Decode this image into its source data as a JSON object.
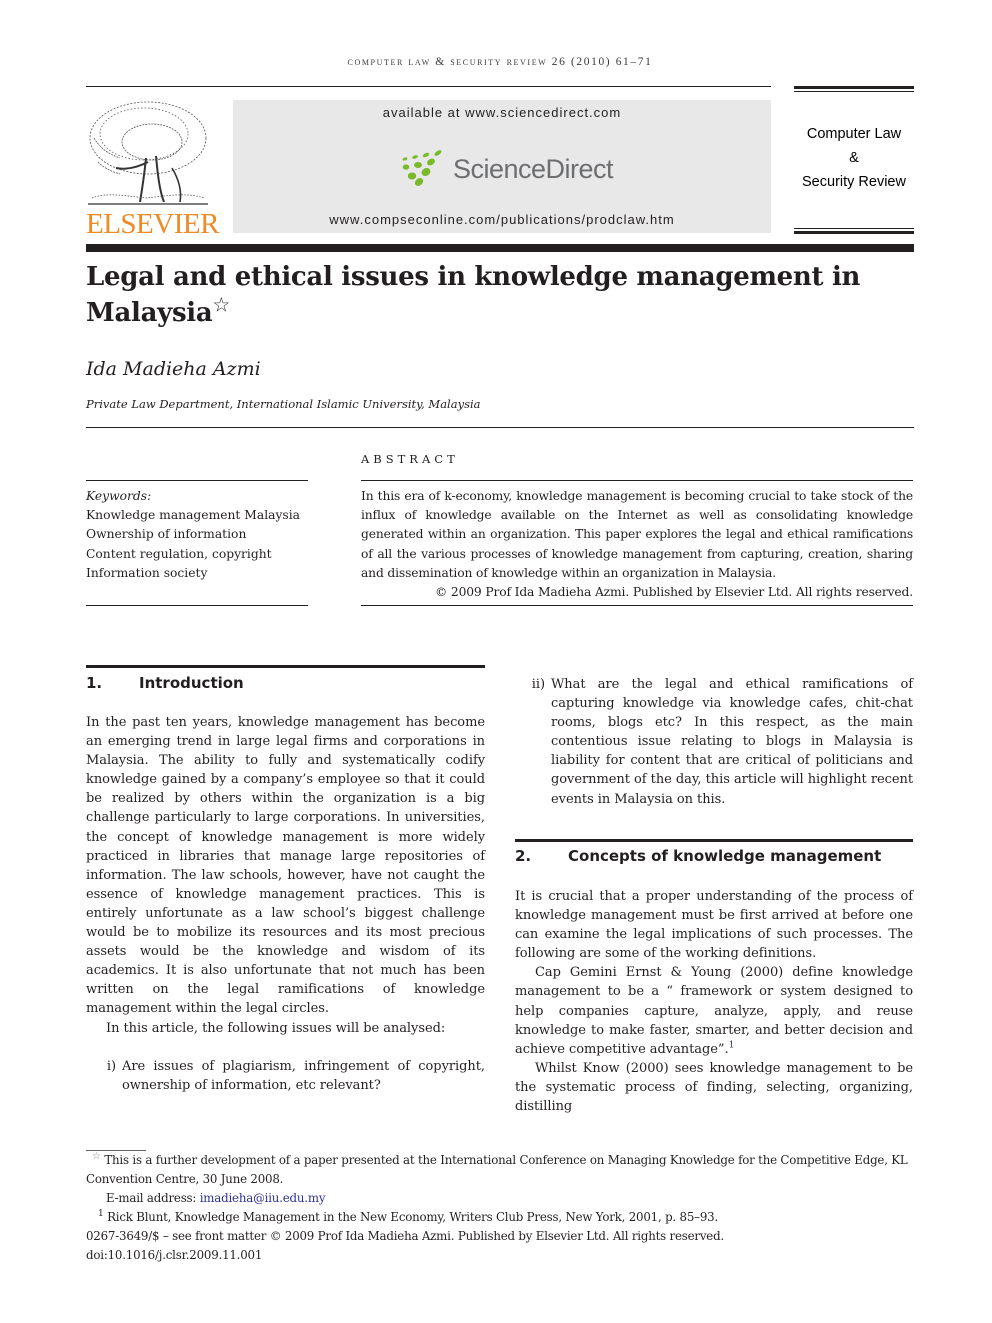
{
  "running_head": "Computer Law & Security Review 26 (2010) 61–71",
  "masthead": {
    "publisher": "ELSEVIER",
    "available_at": "available at www.sciencedirect.com",
    "platform": "ScienceDirect",
    "journal_url": "www.compseconline.com/publications/prodclaw.htm",
    "journal_name_line1": "Computer Law",
    "journal_name_line2": "&",
    "journal_name_line3": "Security Review",
    "colors": {
      "elsevier_orange": "#f08a24",
      "sciencedirect_green": "#7ab929",
      "sciencedirect_gray": "#6d6e71",
      "banner_bg": "#e8e8e8"
    }
  },
  "article": {
    "title": "Legal and ethical issues in knowledge management in Malaysia",
    "title_mark": "☆",
    "author": "Ida Madieha Azmi",
    "affiliation": "Private Law Department, International Islamic University, Malaysia"
  },
  "keywords": {
    "label": "Keywords:",
    "items": [
      "Knowledge management Malaysia",
      "Ownership of information",
      "Content regulation, copyright",
      "Information society"
    ]
  },
  "abstract": {
    "heading": "ABSTRACT",
    "text": "In this era of k-economy, knowledge management is becoming crucial to take stock of the influx of knowledge available on the Internet as well as consolidating knowledge generated within an organization. This paper explores the legal and ethical ramifications of all the various processes of knowledge management from capturing, creation, sharing and dissemination of knowledge within an organization in Malaysia.",
    "copyright": "© 2009 Prof Ida Madieha Azmi. Published by Elsevier Ltd. All rights reserved."
  },
  "sections": [
    {
      "number": "1.",
      "title": "Introduction",
      "paragraphs": [
        "In the past ten years, knowledge management has become an emerging trend in large legal firms and corporations in Malaysia. The ability to fully and systematically codify knowledge gained by a company’s employee so that it could be realized by others within the organization is a big challenge particularly to large corporations. In universities, the concept of knowledge management is more widely practiced in libraries that manage large repositories of information. The law schools, however, have not caught the essence of knowledge management practices. This is entirely unfortunate as a law school’s biggest challenge would be to mobilize its resources and its most precious assets would be the knowledge and wisdom of its academics. It is also unfortunate that not much has been written on the legal ramifications of knowledge management within the legal circles.",
        "In this article, the following issues will be analysed:"
      ],
      "list": [
        {
          "marker": "i)",
          "text": "Are issues of plagiarism, infringement of copyright, ownership of information, etc relevant?"
        },
        {
          "marker": "ii)",
          "text": "What are the legal and ethical ramifications of capturing knowledge via knowledge cafes, chit-chat rooms, blogs etc? In this respect, as the main contentious issue relating to blogs in Malaysia is liability for content that are critical of politicians and government of the day, this article will highlight recent events in Malaysia on this."
        }
      ]
    },
    {
      "number": "2.",
      "title": "Concepts of knowledge management",
      "paragraphs": [
        "It is crucial that a proper understanding of the process of knowledge management must be first arrived at before one can examine the legal implications of such processes. The following are some of the working definitions.",
        "Cap Gemini Ernst & Young (2000) define knowledge management to be a “ framework or system designed to help companies capture, analyze, apply, and reuse knowledge to make faster, smarter, and better decision and achieve competitive advantage”.",
        "Whilst Know (2000) sees knowledge management to be the systematic process of finding, selecting, organizing, distilling"
      ],
      "footnote_ref": "1"
    }
  ],
  "footnotes": {
    "star_mark": "☆",
    "star_note": "This is a further development of a paper presented at the International Conference on Managing Knowledge for the Competitive Edge, KL Convention Centre, 30 June 2008.",
    "email_label": "E-mail address:",
    "email": "imadieha@iiu.edu.my",
    "note1_mark": "1",
    "note1": "Rick Blunt, Knowledge Management in the New Economy, Writers Club Press, New York, 2001, p. 85–93.",
    "front_matter": "0267-3649/$ – see front matter © 2009 Prof Ida Madieha Azmi. Published by Elsevier Ltd. All rights reserved.",
    "doi": "doi:10.1016/j.clsr.2009.11.001"
  }
}
